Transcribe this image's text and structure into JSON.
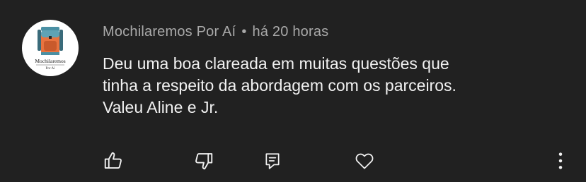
{
  "comment": {
    "author": "Mochilaremos Por Aí",
    "separator": "•",
    "timestamp": "há 20 horas",
    "lines": [
      "Deu uma boa clareada em muitas questões que",
      "tinha a respeito da abordagem com os parceiros.",
      "Valeu Aline e Jr."
    ],
    "avatar": {
      "logo_text": "Mochilaremos",
      "logo_subtext": "Por Aí"
    }
  },
  "actions": [
    {
      "name": "like",
      "icon": "thumbs-up-icon"
    },
    {
      "name": "dislike",
      "icon": "thumbs-down-icon"
    },
    {
      "name": "reply",
      "icon": "reply-icon"
    },
    {
      "name": "heart",
      "icon": "heart-icon"
    },
    {
      "name": "more",
      "icon": "more-vertical-icon"
    }
  ],
  "colors": {
    "background": "#212121",
    "text": "#f1f1f1",
    "meta": "#a9a9a9",
    "icon": "#f1f1f1"
  }
}
